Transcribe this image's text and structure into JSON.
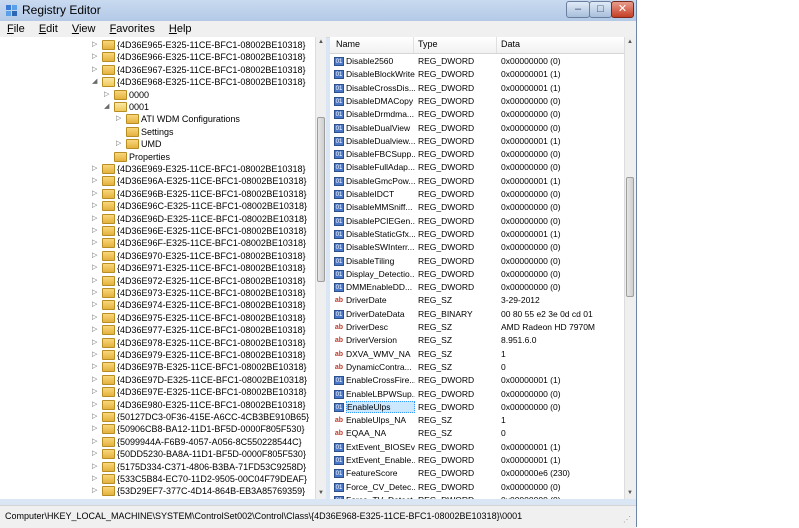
{
  "window": {
    "title": "Registry Editor"
  },
  "menu": [
    "File",
    "Edit",
    "View",
    "Favorites",
    "Help"
  ],
  "tree": [
    {
      "label": "{4D36E965-E325-11CE-BFC1-08002BE10318}",
      "level": 0,
      "arrow": "▷"
    },
    {
      "label": "{4D36E966-E325-11CE-BFC1-08002BE10318}",
      "level": 0,
      "arrow": "▷"
    },
    {
      "label": "{4D36E967-E325-11CE-BFC1-08002BE10318}",
      "level": 0,
      "arrow": "▷"
    },
    {
      "label": "{4D36E968-E325-11CE-BFC1-08002BE10318}",
      "level": 0,
      "arrow": "◢",
      "open": true
    },
    {
      "label": "0000",
      "level": 1,
      "arrow": "▷"
    },
    {
      "label": "0001",
      "level": 1,
      "arrow": "◢",
      "open": true
    },
    {
      "label": "ATI WDM Configurations",
      "level": 2,
      "arrow": "▷"
    },
    {
      "label": "Settings",
      "level": 2,
      "arrow": ""
    },
    {
      "label": "UMD",
      "level": 2,
      "arrow": "▷"
    },
    {
      "label": "Properties",
      "level": 1,
      "arrow": ""
    },
    {
      "label": "{4D36E969-E325-11CE-BFC1-08002BE10318}",
      "level": 0,
      "arrow": "▷"
    },
    {
      "label": "{4D36E96A-E325-11CE-BFC1-08002BE10318}",
      "level": 0,
      "arrow": "▷"
    },
    {
      "label": "{4D36E96B-E325-11CE-BFC1-08002BE10318}",
      "level": 0,
      "arrow": "▷"
    },
    {
      "label": "{4D36E96C-E325-11CE-BFC1-08002BE10318}",
      "level": 0,
      "arrow": "▷"
    },
    {
      "label": "{4D36E96D-E325-11CE-BFC1-08002BE10318}",
      "level": 0,
      "arrow": "▷"
    },
    {
      "label": "{4D36E96E-E325-11CE-BFC1-08002BE10318}",
      "level": 0,
      "arrow": "▷"
    },
    {
      "label": "{4D36E96F-E325-11CE-BFC1-08002BE10318}",
      "level": 0,
      "arrow": "▷"
    },
    {
      "label": "{4D36E970-E325-11CE-BFC1-08002BE10318}",
      "level": 0,
      "arrow": "▷"
    },
    {
      "label": "{4D36E971-E325-11CE-BFC1-08002BE10318}",
      "level": 0,
      "arrow": "▷"
    },
    {
      "label": "{4D36E972-E325-11CE-BFC1-08002BE10318}",
      "level": 0,
      "arrow": "▷"
    },
    {
      "label": "{4D36E973-E325-11CE-BFC1-08002BE10318}",
      "level": 0,
      "arrow": "▷"
    },
    {
      "label": "{4D36E974-E325-11CE-BFC1-08002BE10318}",
      "level": 0,
      "arrow": "▷"
    },
    {
      "label": "{4D36E975-E325-11CE-BFC1-08002BE10318}",
      "level": 0,
      "arrow": "▷"
    },
    {
      "label": "{4D36E977-E325-11CE-BFC1-08002BE10318}",
      "level": 0,
      "arrow": "▷"
    },
    {
      "label": "{4D36E978-E325-11CE-BFC1-08002BE10318}",
      "level": 0,
      "arrow": "▷"
    },
    {
      "label": "{4D36E979-E325-11CE-BFC1-08002BE10318}",
      "level": 0,
      "arrow": "▷"
    },
    {
      "label": "{4D36E97B-E325-11CE-BFC1-08002BE10318}",
      "level": 0,
      "arrow": "▷"
    },
    {
      "label": "{4D36E97D-E325-11CE-BFC1-08002BE10318}",
      "level": 0,
      "arrow": "▷"
    },
    {
      "label": "{4D36E97E-E325-11CE-BFC1-08002BE10318}",
      "level": 0,
      "arrow": "▷"
    },
    {
      "label": "{4D36E980-E325-11CE-BFC1-08002BE10318}",
      "level": 0,
      "arrow": "▷"
    },
    {
      "label": "{50127DC3-0F36-415E-A6CC-4CB3BE910B65}",
      "level": 0,
      "arrow": "▷"
    },
    {
      "label": "{50906CB8-BA12-11D1-BF5D-0000F805F530}",
      "level": 0,
      "arrow": "▷"
    },
    {
      "label": "{5099944A-F6B9-4057-A056-8C550228544C}",
      "level": 0,
      "arrow": "▷"
    },
    {
      "label": "{50DD5230-BA8A-11D1-BF5D-0000F805F530}",
      "level": 0,
      "arrow": "▷"
    },
    {
      "label": "{5175D334-C371-4806-B3BA-71FD53C9258D}",
      "level": 0,
      "arrow": "▷"
    },
    {
      "label": "{533C5B84-EC70-11D2-9505-00C04F79DEAF}",
      "level": 0,
      "arrow": "▷"
    },
    {
      "label": "{53D29EF7-377C-4D14-864B-EB3A85769359}",
      "level": 0,
      "arrow": "▷"
    },
    {
      "label": "{53D29EF7-377C-4D14-864B-EB3A85769359}",
      "level": 0,
      "arrow": "▷"
    }
  ],
  "list": {
    "headers": {
      "name": "Name",
      "type": "Type",
      "data": "Data"
    },
    "rows": [
      {
        "name": "Disable2560",
        "type": "REG_DWORD",
        "data": "0x00000000 (0)",
        "icon": "bin"
      },
      {
        "name": "DisableBlockWrite",
        "type": "REG_DWORD",
        "data": "0x00000001 (1)",
        "icon": "bin"
      },
      {
        "name": "DisableCrossDis...",
        "type": "REG_DWORD",
        "data": "0x00000001 (1)",
        "icon": "bin"
      },
      {
        "name": "DisableDMACopy",
        "type": "REG_DWORD",
        "data": "0x00000000 (0)",
        "icon": "bin"
      },
      {
        "name": "DisableDrmdma...",
        "type": "REG_DWORD",
        "data": "0x00000000 (0)",
        "icon": "bin"
      },
      {
        "name": "DisableDualView",
        "type": "REG_DWORD",
        "data": "0x00000000 (0)",
        "icon": "bin"
      },
      {
        "name": "DisableDualview...",
        "type": "REG_DWORD",
        "data": "0x00000001 (1)",
        "icon": "bin"
      },
      {
        "name": "DisableFBCSupp...",
        "type": "REG_DWORD",
        "data": "0x00000000 (0)",
        "icon": "bin"
      },
      {
        "name": "DisableFullAdap...",
        "type": "REG_DWORD",
        "data": "0x00000000 (0)",
        "icon": "bin"
      },
      {
        "name": "DisableGmcPow...",
        "type": "REG_DWORD",
        "data": "0x00000001 (1)",
        "icon": "bin"
      },
      {
        "name": "DisableIDCT",
        "type": "REG_DWORD",
        "data": "0x00000000 (0)",
        "icon": "bin"
      },
      {
        "name": "DisableMMSniff...",
        "type": "REG_DWORD",
        "data": "0x00000000 (0)",
        "icon": "bin"
      },
      {
        "name": "DisablePCIEGen...",
        "type": "REG_DWORD",
        "data": "0x00000000 (0)",
        "icon": "bin"
      },
      {
        "name": "DisableStaticGfx...",
        "type": "REG_DWORD",
        "data": "0x00000001 (1)",
        "icon": "bin"
      },
      {
        "name": "DisableSWInterr...",
        "type": "REG_DWORD",
        "data": "0x00000000 (0)",
        "icon": "bin"
      },
      {
        "name": "DisableTiling",
        "type": "REG_DWORD",
        "data": "0x00000000 (0)",
        "icon": "bin"
      },
      {
        "name": "Display_Detectio...",
        "type": "REG_DWORD",
        "data": "0x00000000 (0)",
        "icon": "bin"
      },
      {
        "name": "DMMEnableDD...",
        "type": "REG_DWORD",
        "data": "0x00000000 (0)",
        "icon": "bin"
      },
      {
        "name": "DriverDate",
        "type": "REG_SZ",
        "data": "3-29-2012",
        "icon": "sz"
      },
      {
        "name": "DriverDateData",
        "type": "REG_BINARY",
        "data": "00 80 55 e2 3e 0d cd 01",
        "icon": "bin"
      },
      {
        "name": "DriverDesc",
        "type": "REG_SZ",
        "data": "AMD Radeon HD 7970M",
        "icon": "sz"
      },
      {
        "name": "DriverVersion",
        "type": "REG_SZ",
        "data": "8.951.6.0",
        "icon": "sz"
      },
      {
        "name": "DXVA_WMV_NA",
        "type": "REG_SZ",
        "data": "1",
        "icon": "sz"
      },
      {
        "name": "DynamicContra...",
        "type": "REG_SZ",
        "data": "0",
        "icon": "sz"
      },
      {
        "name": "EnableCrossFire...",
        "type": "REG_DWORD",
        "data": "0x00000001 (1)",
        "icon": "bin"
      },
      {
        "name": "EnableLBPWSup...",
        "type": "REG_DWORD",
        "data": "0x00000000 (0)",
        "icon": "bin"
      },
      {
        "name": "EnableUlps",
        "type": "REG_DWORD",
        "data": "0x00000000 (0)",
        "icon": "bin",
        "selected": true
      },
      {
        "name": "EnableUlps_NA",
        "type": "REG_SZ",
        "data": "1",
        "icon": "sz"
      },
      {
        "name": "EQAA_NA",
        "type": "REG_SZ",
        "data": "0",
        "icon": "sz"
      },
      {
        "name": "ExtEvent_BIOSEv...",
        "type": "REG_DWORD",
        "data": "0x00000001 (1)",
        "icon": "bin"
      },
      {
        "name": "ExtEvent_Enable...",
        "type": "REG_DWORD",
        "data": "0x00000001 (1)",
        "icon": "bin"
      },
      {
        "name": "FeatureScore",
        "type": "REG_DWORD",
        "data": "0x000000e6 (230)",
        "icon": "bin"
      },
      {
        "name": "Force_CV_Detec...",
        "type": "REG_DWORD",
        "data": "0x00000000 (0)",
        "icon": "bin"
      },
      {
        "name": "Force_TV_Detect...",
        "type": "REG_DWORD",
        "data": "0x00000000 (0)",
        "icon": "bin"
      }
    ]
  },
  "status": {
    "path": "Computer\\HKEY_LOCAL_MACHINE\\SYSTEM\\ControlSet002\\Control\\Class\\{4D36E968-E325-11CE-BFC1-08002BE10318}\\0001"
  },
  "colors": {
    "selection": "#cce8ff",
    "window_frame": "#dbe6f4",
    "close_button": "#c53e26"
  }
}
